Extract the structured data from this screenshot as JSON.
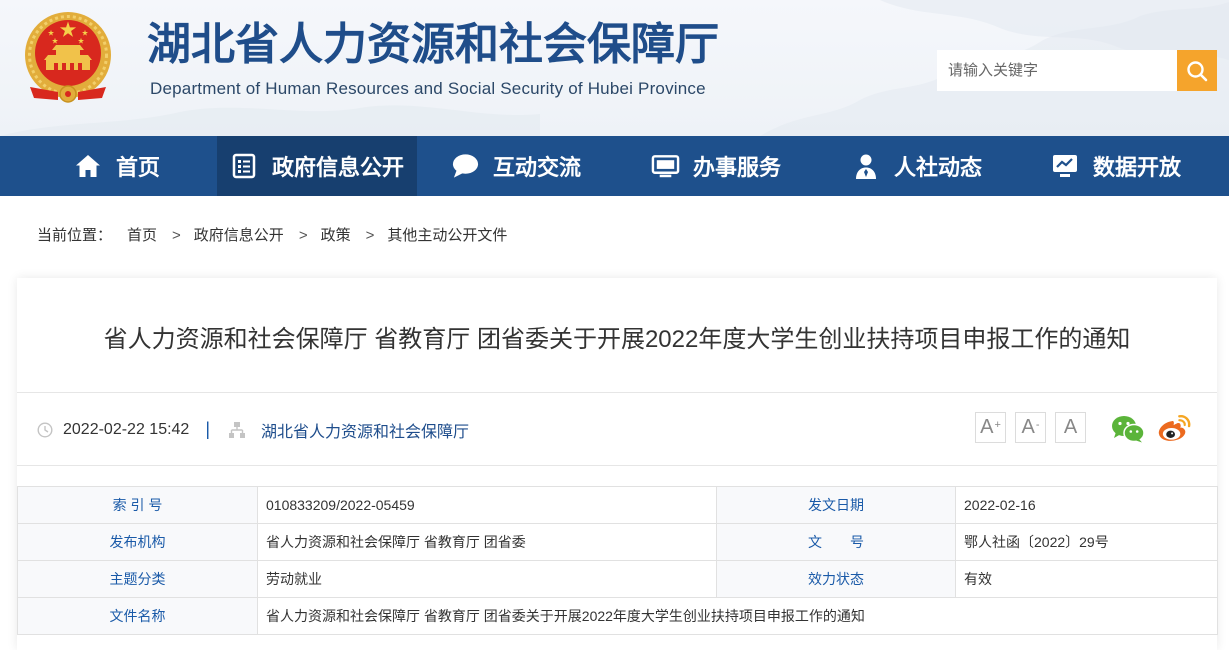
{
  "header": {
    "emblem_icon": "national-emblem-icon",
    "title": "湖北省人力资源和社会保障厅",
    "subtitle": "Department of Human Resources and Social Security of Hubei Province",
    "search": {
      "placeholder": "请输入关键字",
      "button_icon": "search-icon"
    }
  },
  "nav": {
    "items": [
      {
        "label": "首页",
        "icon": "home-icon",
        "active": false
      },
      {
        "label": "政府信息公开",
        "icon": "document-list-icon",
        "active": true
      },
      {
        "label": "互动交流",
        "icon": "chat-bubble-icon",
        "active": false
      },
      {
        "label": "办事服务",
        "icon": "monitor-icon",
        "active": false
      },
      {
        "label": "人社动态",
        "icon": "person-icon",
        "active": false
      },
      {
        "label": "数据开放",
        "icon": "data-chart-icon",
        "active": false
      }
    ]
  },
  "breadcrumb": {
    "prefix": "当前位置：",
    "separator": ">",
    "items": [
      "首页",
      "政府信息公开",
      "政策",
      "其他主动公开文件"
    ]
  },
  "article": {
    "title": "省人力资源和社会保障厅 省教育厅 团省委关于开展2022年度大学生创业扶持项目申报工作的通知",
    "meta": {
      "time_icon": "clock-icon",
      "datetime": "2022-02-22 15:42",
      "separator": "|",
      "source_icon": "sitemap-icon",
      "source": "湖北省人力资源和社会保障厅"
    },
    "font_size_buttons": [
      {
        "letter": "A",
        "mark": "+"
      },
      {
        "letter": "A",
        "mark": "-"
      },
      {
        "letter": "A"
      }
    ],
    "share_icons": [
      "wechat-icon",
      "weibo-icon"
    ]
  },
  "info_table": {
    "rows": [
      {
        "label": "索 引 号",
        "value": "010833209/2022-05459",
        "label2": "发文日期",
        "value2": "2022-02-16"
      },
      {
        "label": "发布机构",
        "value": "省人力资源和社会保障厅 省教育厅 团省委",
        "label2": "文　　号",
        "value2": "鄂人社函〔2022〕29号"
      },
      {
        "label": "主题分类",
        "value": "劳动就业",
        "label2": "效力状态",
        "value2": "有效"
      },
      {
        "label": "文件名称",
        "value": "省人力资源和社会保障厅 省教育厅 团省委关于开展2022年度大学生创业扶持项目申报工作的通知"
      }
    ]
  },
  "colors": {
    "title_blue": "#1f4d8a",
    "nav_bg": "#1e508c",
    "nav_active_bg": "#173f6f",
    "search_button": "#f5a42c",
    "label_blue": "#1a5aa8",
    "wechat_green": "#5bb43a",
    "weibo_orange": "#ec6a1f"
  }
}
